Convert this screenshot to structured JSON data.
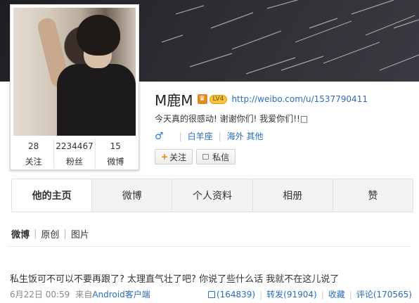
{
  "profile": {
    "name": "M鹿M",
    "vip_badge": "LV4",
    "url": "http://weibo.com/u/1537790411",
    "bio": "今天真的很感动! 谢谢你们! 我爱你们!!□",
    "gender_symbol": "♂",
    "constellation": "白羊座",
    "location": "海外 其他",
    "follow_label": "关注",
    "message_label": "私信"
  },
  "stats": [
    {
      "value": "28",
      "label": "关注"
    },
    {
      "value": "2234467",
      "label": "粉丝"
    },
    {
      "value": "15",
      "label": "微博"
    }
  ],
  "tabs": [
    {
      "label": "他的主页",
      "active": true
    },
    {
      "label": "微博",
      "active": false
    },
    {
      "label": "个人资料",
      "active": false
    },
    {
      "label": "相册",
      "active": false
    },
    {
      "label": "赞",
      "active": false
    }
  ],
  "feed_tabs": [
    {
      "label": "微博",
      "active": true
    },
    {
      "label": "原创",
      "active": false
    },
    {
      "label": "图片",
      "active": false
    }
  ],
  "post": {
    "text": "私生饭可不可以不要再跟了? 太理直气壮了吧? 你说了些什么话 我就不在这儿说了",
    "time": "6月22日 00:59",
    "source_prefix": "来自",
    "source": "Android客户端",
    "like": "(164839)",
    "repost": "转发(91904)",
    "favorite": "收藏",
    "comment": "评论(170565)"
  },
  "icons": [
    "crown-icon",
    "vip-badge-icon",
    "male-icon",
    "plus-icon",
    "message-icon",
    "like-icon"
  ],
  "colors": {
    "link": "#2a6db8",
    "follow_plus": "#f08200",
    "tab_bg": "#f2f2f2"
  }
}
